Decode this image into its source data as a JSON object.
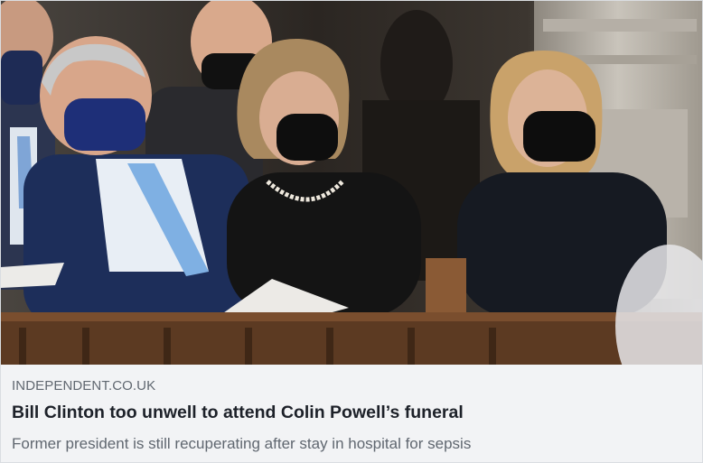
{
  "link_preview": {
    "source": "INDEPENDENT.CO.UK",
    "headline": "Bill Clinton too unwell to attend Colin Powell’s funeral",
    "description": "Former president is still recuperating after stay in hospital for sepsis"
  },
  "colors": {
    "meta_background": "#f2f3f5",
    "headline_text": "#1d2129",
    "secondary_text": "#606770"
  }
}
